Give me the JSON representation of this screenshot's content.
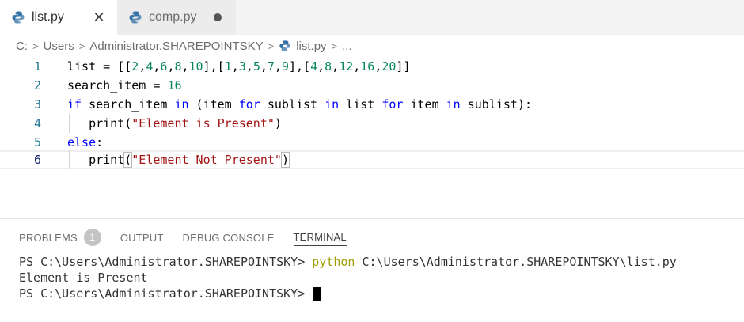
{
  "tabs": [
    {
      "label": "list.py",
      "close": "✕"
    },
    {
      "label": "comp.py"
    }
  ],
  "breadcrumb": {
    "parts": [
      "C:",
      "Users",
      "Administrator.SHAREPOINTSKY",
      "list.py",
      "..."
    ],
    "separator": ">"
  },
  "editor": {
    "line_numbers": [
      "1",
      "2",
      "3",
      "4",
      "5",
      "6"
    ]
  },
  "panel": {
    "tabs": [
      "PROBLEMS",
      "OUTPUT",
      "DEBUG CONSOLE",
      "TERMINAL"
    ],
    "problems_count": "1",
    "active_tab": "TERMINAL"
  },
  "terminal": {
    "prompt1": "PS C:\\Users\\Administrator.SHAREPOINTSKY> ",
    "command": "python",
    "args": " C:\\Users\\Administrator.SHAREPOINTSKY\\list.py",
    "output": "Element is Present",
    "prompt2": "PS C:\\Users\\Administrator.SHAREPOINTSKY> "
  },
  "colors": {
    "keyword": "#0000ff",
    "number": "#098658",
    "string": "#a31515",
    "line_number": "#237893",
    "python_blue": "#3572A5",
    "python_yellow": "#FFD43B"
  }
}
